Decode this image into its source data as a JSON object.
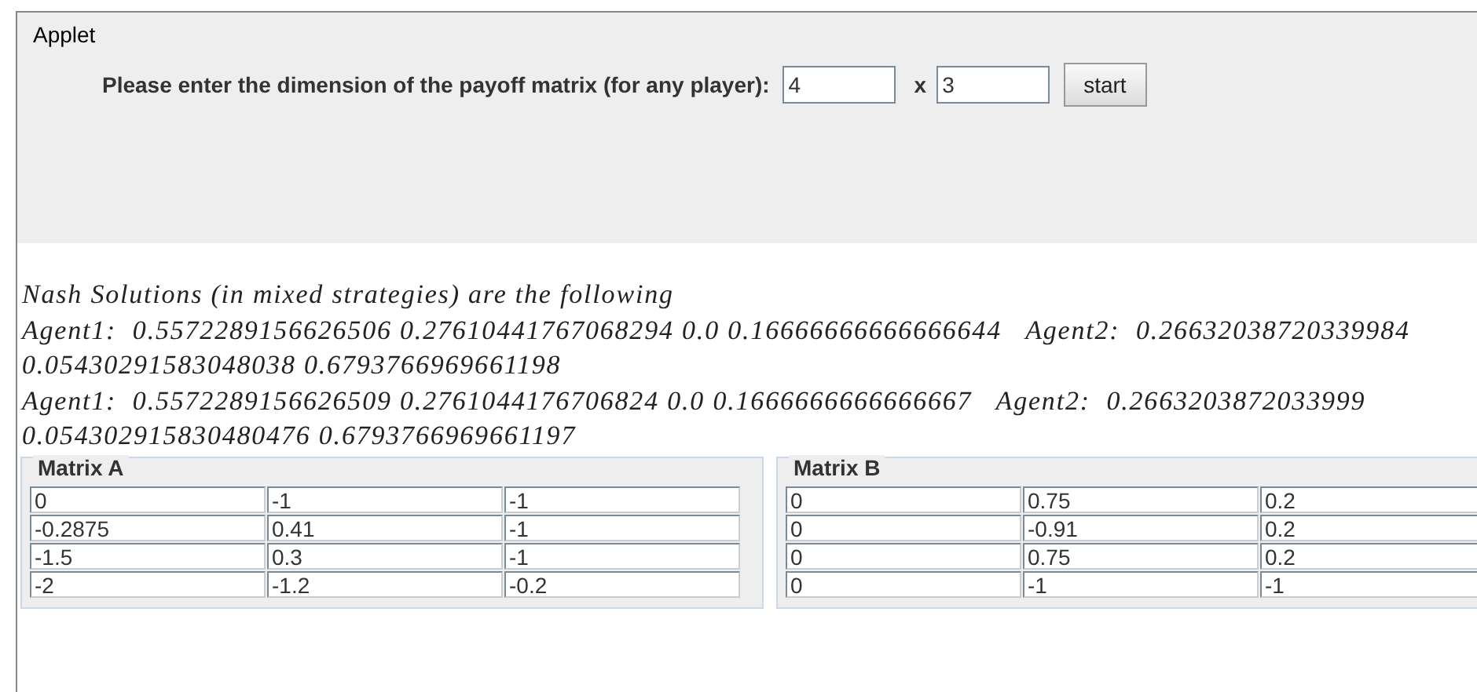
{
  "applet": {
    "title": "Applet"
  },
  "dimension_form": {
    "prompt": "Please enter the dimension of the payoff matrix (for any player):",
    "rows_value": "4",
    "separator": "x",
    "cols_value": "3",
    "button": "start"
  },
  "results": [
    "Nash Solutions (in mixed strategies) are the following",
    "Agent1:  0.5572289156626506 0.27610441767068294 0.0 0.16666666666666644   Agent2:  0.26632038720339984",
    "0.05430291583048038 0.6793766969661198",
    "Agent1:  0.5572289156626509 0.2761044176706824 0.0 0.1666666666666667   Agent2:  0.2663203872033999",
    "0.054302915830480476 0.6793766969661197"
  ],
  "matrices": [
    {
      "title": "Matrix A",
      "rows": [
        [
          "0",
          "-1",
          "-1"
        ],
        [
          "-0.2875",
          "0.41",
          "-1"
        ],
        [
          "-1.5",
          "0.3",
          "-1"
        ],
        [
          "-2",
          "-1.2",
          "-0.2"
        ]
      ]
    },
    {
      "title": "Matrix B",
      "rows": [
        [
          "0",
          "0.75",
          "0.2"
        ],
        [
          "0",
          "-0.91",
          "0.2"
        ],
        [
          "0",
          "0.75",
          "0.2"
        ],
        [
          "0",
          "-1",
          "-1"
        ]
      ]
    }
  ]
}
